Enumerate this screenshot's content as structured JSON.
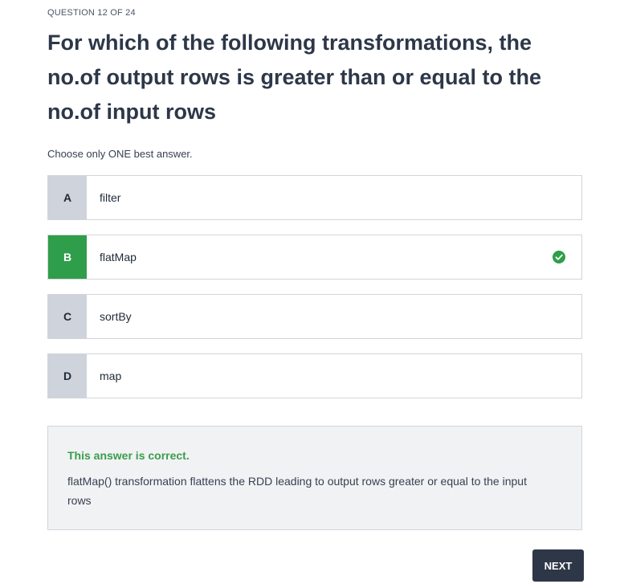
{
  "quiz": {
    "counter": "QUESTION 12 OF 24",
    "question": "For which of the following transformations, the no.of output rows is greater than or equal to the no.of input rows",
    "instruction": "Choose only ONE best answer."
  },
  "options": [
    {
      "letter": "A",
      "text": "filter",
      "selected": false
    },
    {
      "letter": "B",
      "text": "flatMap",
      "selected": true,
      "status_icon": "check-circle-icon"
    },
    {
      "letter": "C",
      "text": "sortBy",
      "selected": false
    },
    {
      "letter": "D",
      "text": "map",
      "selected": false
    }
  ],
  "feedback": {
    "title": "This answer is correct.",
    "body": "flatMap() transformation flattens the RDD leading to output rows greater or equal to the input rows"
  },
  "next_label": "NEXT",
  "colors": {
    "correct": "#2f9e4a",
    "letter_bg": "#cfd3db",
    "button_bg": "#2d3748",
    "feedback_bg": "#f1f2f4"
  }
}
